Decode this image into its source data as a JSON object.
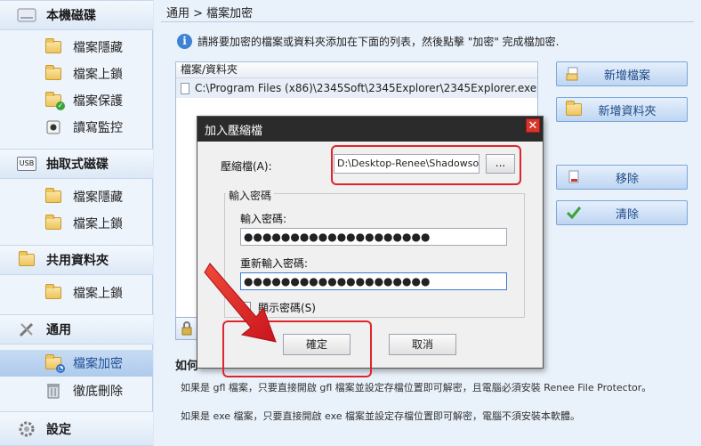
{
  "sidebar": {
    "sections": [
      {
        "label": "本機磁碟",
        "icon": "disk-icon",
        "items": [
          {
            "label": "檔案隱藏",
            "icon": "hide-folder-icon"
          },
          {
            "label": "檔案上鎖",
            "icon": "lock-folder-icon"
          },
          {
            "label": "檔案保護",
            "icon": "protect-folder-icon"
          },
          {
            "label": "讀寫監控",
            "icon": "monitor-icon"
          }
        ]
      },
      {
        "label": "抽取式磁碟",
        "icon": "usb-icon",
        "usb_text": "USB",
        "items": [
          {
            "label": "檔案隱藏",
            "icon": "hide-folder-icon"
          },
          {
            "label": "檔案上鎖",
            "icon": "lock-folder-icon"
          }
        ]
      },
      {
        "label": "共用資料夾",
        "icon": "shared-folder-icon",
        "items": [
          {
            "label": "檔案上鎖",
            "icon": "lock-folder-icon"
          }
        ]
      },
      {
        "label": "通用",
        "icon": "tools-icon",
        "items": [
          {
            "label": "檔案加密",
            "icon": "encrypt-folder-icon",
            "active": true
          },
          {
            "label": "徹底刪除",
            "icon": "trash-icon"
          }
        ]
      },
      {
        "label": "設定",
        "icon": "gear-icon",
        "items": []
      }
    ]
  },
  "main": {
    "breadcrumb": "通用 > 檔案加密",
    "info_text": "請將要加密的檔案或資料夾添加在下面的列表，然後點擊 \"加密\" 完成檔加密.",
    "list_header": "檔案/資料夾",
    "files": [
      "C:\\Program Files (x86)\\2345Soft\\2345Explorer\\2345Explorer.exe"
    ],
    "buttons": {
      "add_file": "新增檔案",
      "add_folder": "新增資料夾",
      "remove": "移除",
      "clear": "清除"
    },
    "howto_title": "如何",
    "howto_lines": [
      "如果是 gfl 檔案，只要直接開啟 gfl 檔案並設定存檔位置即可解密，且電腦必須安裝 Renee File Protector。",
      "如果是 exe 檔案，只要直接開啟 exe 檔案並設定存檔位置即可解密，電腦不須安裝本軟體。"
    ]
  },
  "dialog": {
    "title": "加入壓縮檔",
    "close": "✕",
    "archive_label": "壓縮檔(A):",
    "archive_value": "D:\\Desktop-Renee\\Shadowsocks",
    "browse": "...",
    "group_title": "輸入密碼",
    "password_label": "輸入密碼:",
    "password_value": "●●●●●●●●●●●●●●●●●●●●",
    "confirm_label": "重新輸入密碼:",
    "confirm_value": "●●●●●●●●●●●●●●●●●●●●",
    "show_password": "顯示密碼(S)",
    "ok": "確定",
    "cancel": "取消"
  },
  "colors": {
    "annotation": "#e0242c",
    "accent": "#3c83d6"
  }
}
